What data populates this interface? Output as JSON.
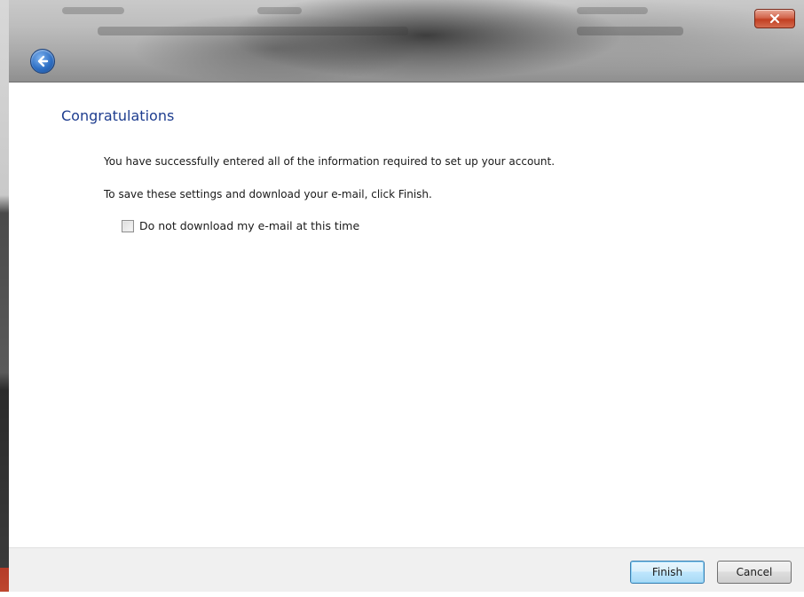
{
  "window": {
    "close_glyph": "x"
  },
  "page": {
    "heading": "Congratulations",
    "paragraph1": "You have successfully entered all of the information required to set up your account.",
    "paragraph2": "To save these settings and download your e-mail, click Finish.",
    "checkbox_label": "Do not download my e-mail at this time",
    "checkbox_checked": false
  },
  "footer": {
    "finish_label": "Finish",
    "cancel_label": "Cancel"
  },
  "colors": {
    "heading": "#1e3d8f",
    "footer_bg": "#f0f0f0",
    "default_button_border": "#3c7fb1"
  },
  "icons": {
    "back": "back-arrow-icon",
    "close": "close-icon"
  }
}
